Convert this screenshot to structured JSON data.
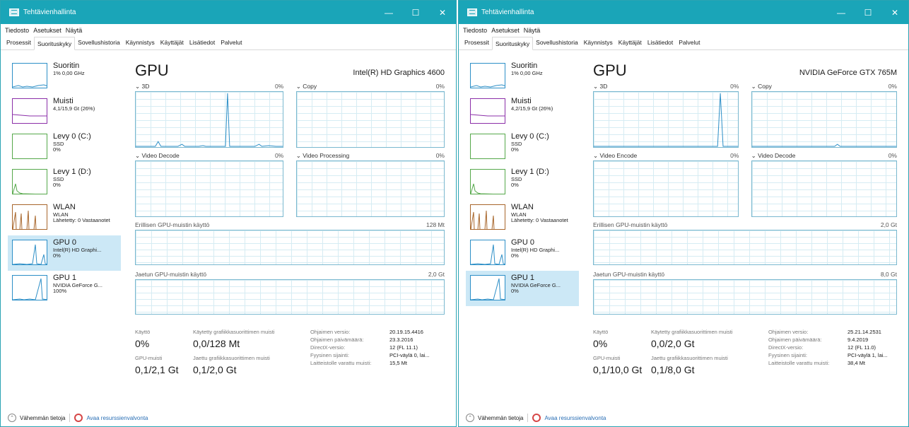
{
  "windows": [
    {
      "title": "Tehtävienhallinta",
      "menu": [
        "Tiedosto",
        "Asetukset",
        "Näytä"
      ],
      "tabs": [
        "Prosessit",
        "Suorituskyky",
        "Sovellushistoria",
        "Käynnistys",
        "Käyttäjät",
        "Lisätiedot",
        "Palvelut"
      ],
      "active_tab": "Suorituskyky",
      "sidebar": [
        {
          "title": "Suoritin",
          "sub1": "1% 0,00 GHz",
          "sub2": "",
          "sub3": "",
          "color": "#2d8fc7"
        },
        {
          "title": "Muisti",
          "sub1": "4,1/15,9 Gt (26%)",
          "sub2": "",
          "sub3": "",
          "color": "#8b2fa8"
        },
        {
          "title": "Levy 0 (C:)",
          "sub1": "SSD",
          "sub2": "0%",
          "sub3": "",
          "color": "#55a84a"
        },
        {
          "title": "Levy 1 (D:)",
          "sub1": "SSD",
          "sub2": "0%",
          "sub3": "",
          "color": "#55a84a"
        },
        {
          "title": "WLAN",
          "sub1": "WLAN",
          "sub2": "Lähetetty: 0 Vastaanotet",
          "sub3": "",
          "color": "#a8662b"
        },
        {
          "title": "GPU 0",
          "sub1": "Intel(R) HD Graphi...",
          "sub2": "0%",
          "sub3": "",
          "color": "#2d8fc7"
        },
        {
          "title": "GPU 1",
          "sub1": "NVIDIA GeForce G...",
          "sub2": "100%",
          "sub3": "",
          "color": "#2d8fc7"
        }
      ],
      "selected_index": 5,
      "gpu": {
        "title": "GPU",
        "model": "Intel(R) HD Graphics 4600",
        "graphs": [
          {
            "name": "3D",
            "pct": "0%"
          },
          {
            "name": "Copy",
            "pct": "0%"
          },
          {
            "name": "Video Decode",
            "pct": "0%"
          },
          {
            "name": "Video Processing",
            "pct": "0%"
          }
        ],
        "dedicated_label": "Erillisen GPU-muistin käyttö",
        "dedicated_max": "128 Mt",
        "shared_label": "Jaetun GPU-muistin käyttö",
        "shared_max": "2,0 Gt",
        "stats": {
          "usage_label": "Käyttö",
          "usage_value": "0%",
          "dedicated_used_label": "Käytetty grafiikkasuorittimen muisti",
          "dedicated_used_value": "0,0/128 Mt",
          "gpu_mem_label": "GPU-muisti",
          "gpu_mem_value": "0,1/2,1 Gt",
          "shared_used_label": "Jaettu grafiikkasuorittimen muisti",
          "shared_used_value": "0,1/2,0 Gt"
        },
        "info": [
          {
            "k": "Ohjaimen versio:",
            "v": "20.19.15.4416"
          },
          {
            "k": "Ohjaimen päivämäärä:",
            "v": "23.3.2016"
          },
          {
            "k": "DirectX-versio:",
            "v": "12 (FL 11.1)"
          },
          {
            "k": "Fyysinen sijainti:",
            "v": "PCI-väylä 0, lai..."
          },
          {
            "k": "Laitteistolle varattu muisti:",
            "v": "15,5 Mt"
          }
        ]
      },
      "footer": {
        "less": "Vähemmän tietoja",
        "monitor": "Avaa resurssienvalvonta"
      }
    },
    {
      "title": "Tehtävienhallinta",
      "menu": [
        "Tiedosto",
        "Asetukset",
        "Näytä"
      ],
      "tabs": [
        "Prosessit",
        "Suorituskyky",
        "Sovellushistoria",
        "Käynnistys",
        "Käyttäjät",
        "Lisätiedot",
        "Palvelut"
      ],
      "active_tab": "Suorituskyky",
      "sidebar": [
        {
          "title": "Suoritin",
          "sub1": "1% 0,00 GHz",
          "sub2": "",
          "sub3": "",
          "color": "#2d8fc7"
        },
        {
          "title": "Muisti",
          "sub1": "4,2/15,9 Gt (26%)",
          "sub2": "",
          "sub3": "",
          "color": "#8b2fa8"
        },
        {
          "title": "Levy 0 (C:)",
          "sub1": "SSD",
          "sub2": "0%",
          "sub3": "",
          "color": "#55a84a"
        },
        {
          "title": "Levy 1 (D:)",
          "sub1": "SSD",
          "sub2": "0%",
          "sub3": "",
          "color": "#55a84a"
        },
        {
          "title": "WLAN",
          "sub1": "WLAN",
          "sub2": "Lähetetty: 0 Vastaanotet",
          "sub3": "",
          "color": "#a8662b"
        },
        {
          "title": "GPU 0",
          "sub1": "Intel(R) HD Graphi...",
          "sub2": "0%",
          "sub3": "",
          "color": "#2d8fc7"
        },
        {
          "title": "GPU 1",
          "sub1": "NVIDIA GeForce G...",
          "sub2": "0%",
          "sub3": "",
          "color": "#2d8fc7"
        }
      ],
      "selected_index": 6,
      "gpu": {
        "title": "GPU",
        "model": "NVIDIA GeForce GTX 765M",
        "graphs": [
          {
            "name": "3D",
            "pct": "0%"
          },
          {
            "name": "Copy",
            "pct": "0%"
          },
          {
            "name": "Video Encode",
            "pct": "0%"
          },
          {
            "name": "Video Decode",
            "pct": "0%"
          }
        ],
        "dedicated_label": "Erillisen GPU-muistin käyttö",
        "dedicated_max": "2,0 Gt",
        "shared_label": "Jaetun GPU-muistin käyttö",
        "shared_max": "8,0 Gt",
        "stats": {
          "usage_label": "Käyttö",
          "usage_value": "0%",
          "dedicated_used_label": "Käytetty grafiikkasuorittimen muisti",
          "dedicated_used_value": "0,0/2,0 Gt",
          "gpu_mem_label": "GPU-muisti",
          "gpu_mem_value": "0,1/10,0 Gt",
          "shared_used_label": "Jaettu grafiikkasuorittimen muisti",
          "shared_used_value": "0,1/8,0 Gt"
        },
        "info": [
          {
            "k": "Ohjaimen versio:",
            "v": "25.21.14.2531"
          },
          {
            "k": "Ohjaimen päivämäärä:",
            "v": "9.4.2019"
          },
          {
            "k": "DirectX-versio:",
            "v": "12 (FL 11.0)"
          },
          {
            "k": "Fyysinen sijainti:",
            "v": "PCI-väylä 1, lai..."
          },
          {
            "k": "Laitteistolle varattu muisti:",
            "v": "38,4 Mt"
          }
        ]
      },
      "footer": {
        "less": "Vähemmän tietoja",
        "monitor": "Avaa resurssienvalvonta"
      }
    }
  ]
}
